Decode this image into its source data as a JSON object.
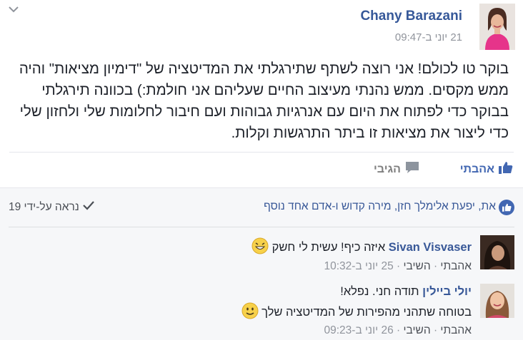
{
  "post": {
    "author": "Chany Barazani",
    "time": "21 יוני ב-09:47",
    "text": "בוקר טו לכולם! אני רוצה לשתף שתירגלתי את המדיטציה של \"דימיון מציאות\" והיה ממש מקסים. ממש נהנתי מעיצוב החיים שעליהם אני חולמת:) בכוונה תירגלתי בבוקר כדי לפתוח את היום עם אנרגיות גבוהות ועם חיבור לחלומות שלי ולחזון שלי כדי ליצור את מציאות זו ביתר התרגשות וקלות."
  },
  "actions": {
    "like": "אהבתי",
    "comment": "הגיבי"
  },
  "reactions": {
    "likes_text": "את, יפעת אלימלך חזן, מירה קדוש ו-אדם אחד נוסף",
    "seen_by": "נראה על-ידי 19"
  },
  "comments": [
    {
      "author": "Sivan Visvaser",
      "text": "איזה כיף! עשית לי חשק",
      "like": "אהבתי",
      "reply": "השיבי",
      "time": "25 יוני ב-10:32"
    },
    {
      "author": "יולי ביילין",
      "text_line1": "תודה חני. נפלא!",
      "text_line2": "בטוחה שתהני מהפירות של המדיטציה שלך",
      "like": "אהבתי",
      "reply": "השיבי",
      "time": "26 יוני ב-09:23"
    }
  ],
  "colors": {
    "link": "#365899",
    "meta": "#90949c",
    "like_blue": "#4267b2",
    "bar_bg": "#f6f7f9"
  },
  "icons": [
    "chevron-down-icon",
    "like-icon",
    "comment-icon",
    "checkmark-icon",
    "grinning-emoji",
    "smiley-emoji"
  ]
}
